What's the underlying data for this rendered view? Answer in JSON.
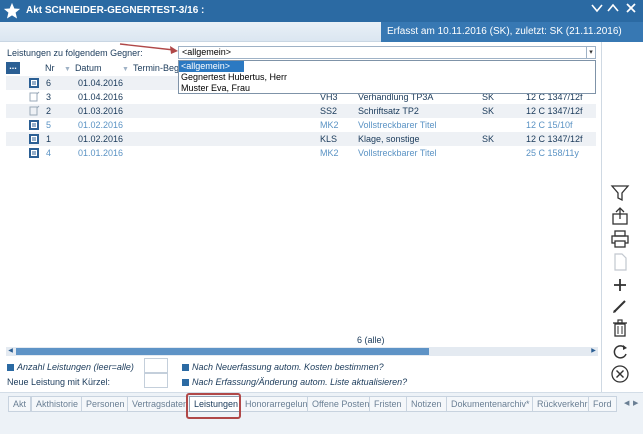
{
  "window": {
    "title": "Akt SCHNEIDER-GEGNERTEST-3/16 :",
    "erfasst": "Erfasst am 10.11.2016 (SK), zuletzt: SK (21.11.2016)"
  },
  "gegner": {
    "label": "Leistungen zu folgendem Gegner:",
    "selected": "<allgemein>",
    "options": [
      "<allgemein>",
      "Gegnertest Hubertus, Herr",
      "Muster Eva, Frau"
    ]
  },
  "table": {
    "menu_label": "...",
    "headers": {
      "nr": "Nr",
      "datum": "Datum",
      "termin": "Termin-Beg"
    },
    "rows": [
      {
        "nr": "6",
        "datum": "01.04.2016",
        "code": "",
        "text": "",
        "user": "",
        "gz": "",
        "blue": false
      },
      {
        "nr": "3",
        "datum": "01.04.2016",
        "code": "VH3",
        "text": "Verhandlung TP3A",
        "user": "SK",
        "gz": "12 C 1347/12f",
        "blue": false
      },
      {
        "nr": "2",
        "datum": "01.03.2016",
        "code": "SS2",
        "text": "Schriftsatz TP2",
        "user": "SK",
        "gz": "12 C 1347/12f",
        "blue": false
      },
      {
        "nr": "5",
        "datum": "01.02.2016",
        "code": "MK2",
        "text": "Vollstreckbarer Titel",
        "user": "",
        "gz": "12 C 15/10f",
        "blue": true
      },
      {
        "nr": "1",
        "datum": "01.02.2016",
        "code": "KLS",
        "text": "Klage, sonstige",
        "user": "SK",
        "gz": "12 C 1347/12f",
        "blue": false
      },
      {
        "nr": "4",
        "datum": "01.01.2016",
        "code": "MK2",
        "text": "Vollstreckbarer Titel",
        "user": "",
        "gz": "25 C 158/11y",
        "blue": true
      }
    ],
    "count": "6 (alle)"
  },
  "options": {
    "anzahl_label": "Anzahl Leistungen (leer=alle)",
    "kuerzel_label": "Neue Leistung mit Kürzel:",
    "kosten_label": "Nach Neuerfassung autom. Kosten bestimmen?",
    "aktualisieren_label": "Nach Erfassung/Änderung autom. Liste aktualisieren?"
  },
  "tabs": [
    "Akt",
    "Akthistorie",
    "Personen",
    "Vertragsdaten",
    "Leistungen",
    "Honorarregelung",
    "Offene Posten",
    "Fristen",
    "Notizen",
    "Dokumentenarchiv*",
    "Rückverkehr",
    "Ford"
  ],
  "active_tab": "Leistungen",
  "colors": {
    "titlebar": "#2b6aa3",
    "accent": "#3778b3",
    "highlight": "#b04848"
  }
}
